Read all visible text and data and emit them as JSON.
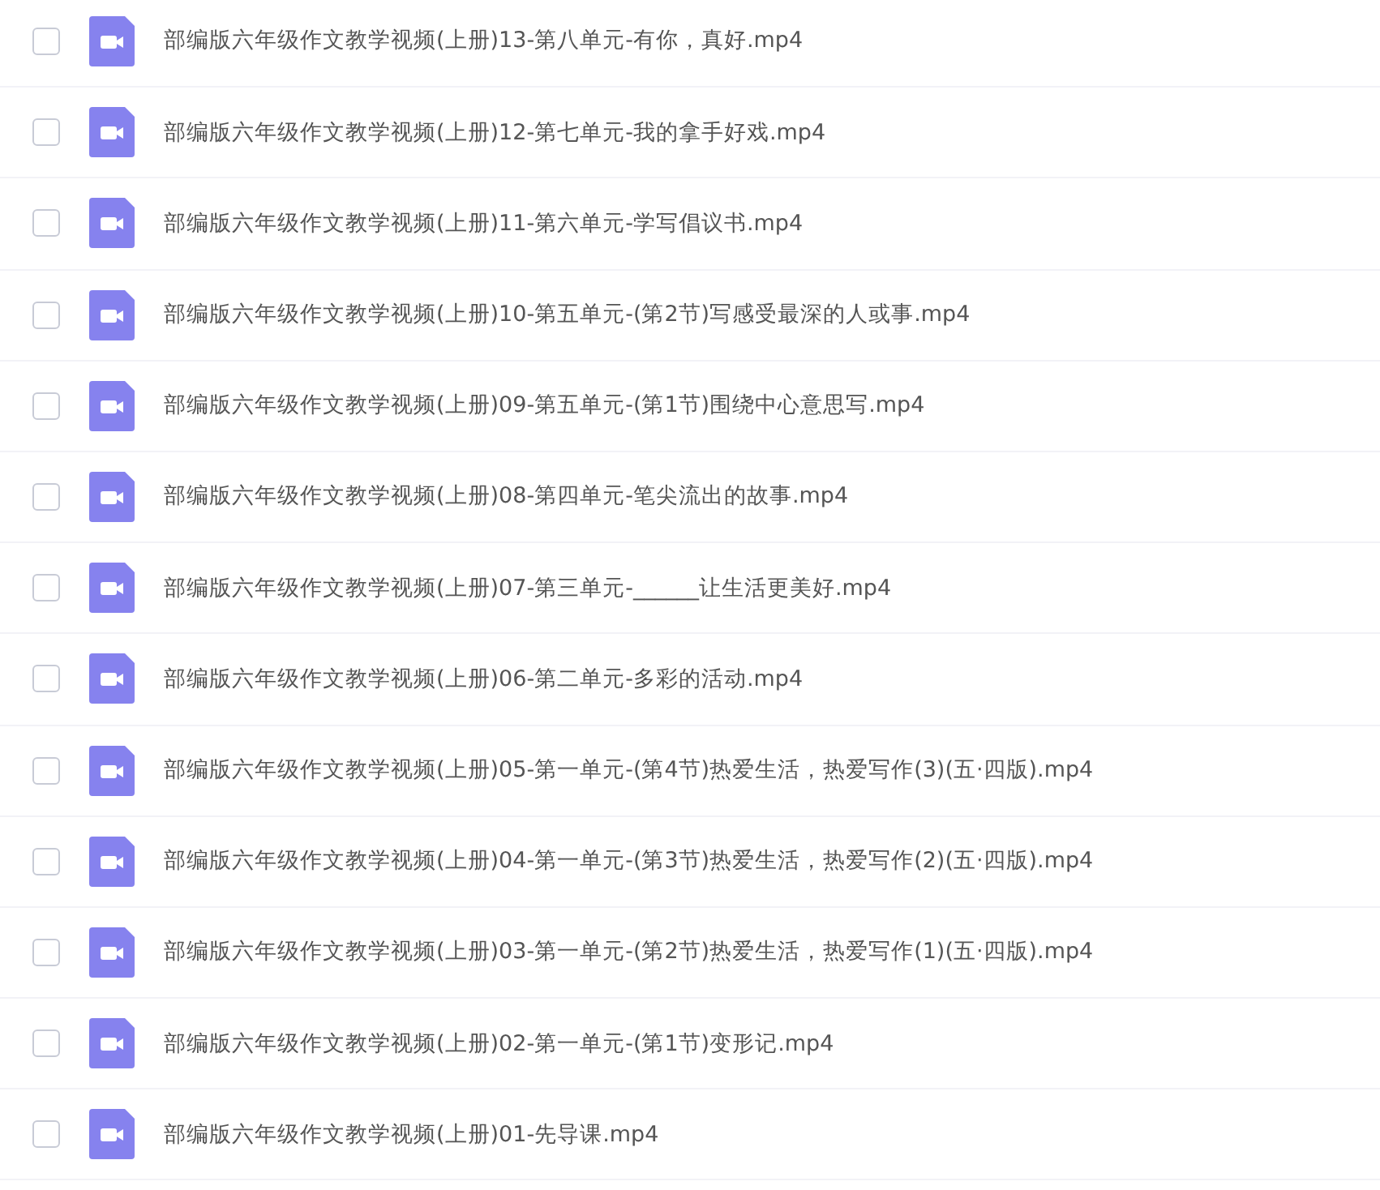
{
  "files": [
    {
      "name": "部编版六年级作文教学视频(上册)13-第八单元-有你，真好.mp4",
      "checked": false
    },
    {
      "name": "部编版六年级作文教学视频(上册)12-第七单元-我的拿手好戏.mp4",
      "checked": false
    },
    {
      "name": "部编版六年级作文教学视频(上册)11-第六单元-学写倡议书.mp4",
      "checked": false
    },
    {
      "name": "部编版六年级作文教学视频(上册)10-第五单元-(第2节)写感受最深的人或事.mp4",
      "checked": false
    },
    {
      "name": "部编版六年级作文教学视频(上册)09-第五单元-(第1节)围绕中心意思写.mp4",
      "checked": false
    },
    {
      "name": "部编版六年级作文教学视频(上册)08-第四单元-笔尖流出的故事.mp4",
      "checked": false
    },
    {
      "name": "部编版六年级作文教学视频(上册)07-第三单元-______让生活更美好.mp4",
      "checked": false
    },
    {
      "name": "部编版六年级作文教学视频(上册)06-第二单元-多彩的活动.mp4",
      "checked": false
    },
    {
      "name": "部编版六年级作文教学视频(上册)05-第一单元-(第4节)热爱生活，热爱写作(3)(五·四版).mp4",
      "checked": false
    },
    {
      "name": "部编版六年级作文教学视频(上册)04-第一单元-(第3节)热爱生活，热爱写作(2)(五·四版).mp4",
      "checked": false
    },
    {
      "name": "部编版六年级作文教学视频(上册)03-第一单元-(第2节)热爱生活，热爱写作(1)(五·四版).mp4",
      "checked": false
    },
    {
      "name": "部编版六年级作文教学视频(上册)02-第一单元-(第1节)变形记.mp4",
      "checked": false
    },
    {
      "name": "部编版六年级作文教学视频(上册)01-先导课.mp4",
      "checked": false
    }
  ]
}
